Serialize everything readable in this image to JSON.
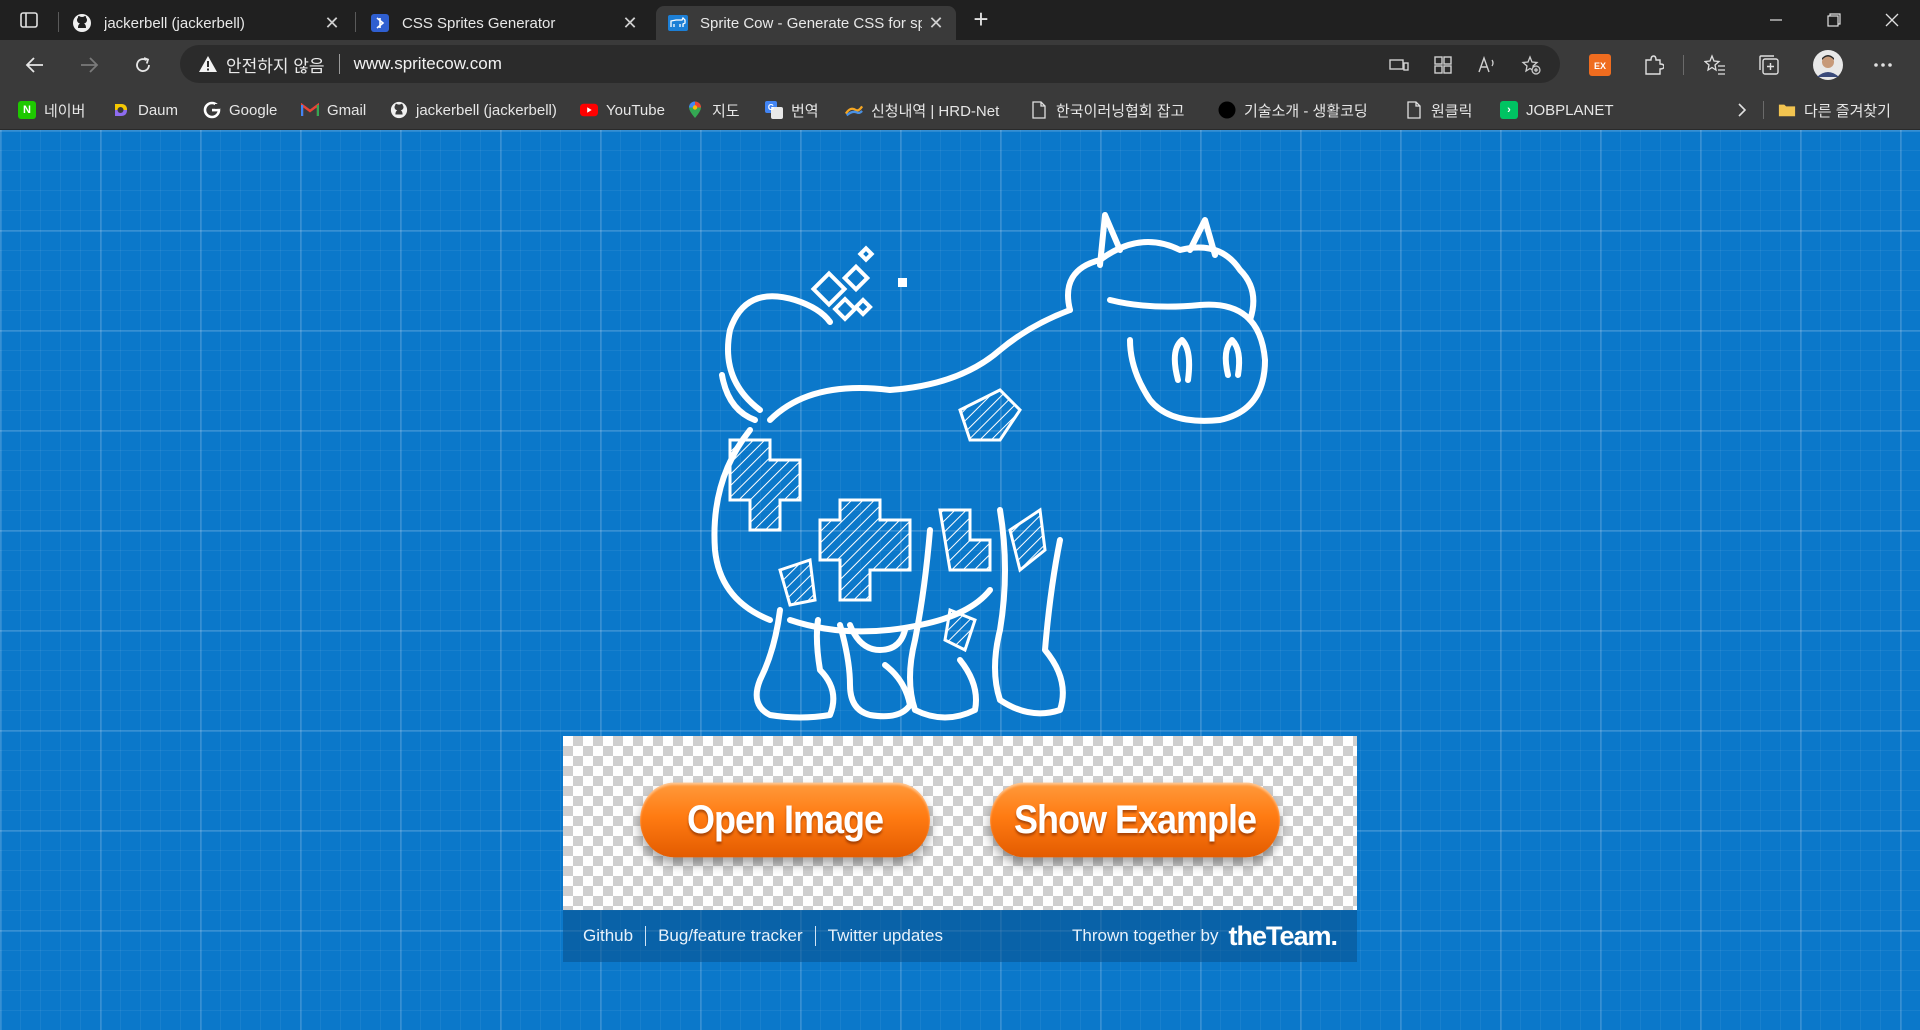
{
  "tabs": [
    {
      "title": "jackerbell (jackerbell)",
      "icon": "github-icon"
    },
    {
      "title": "CSS Sprites Generator",
      "icon": "sprites-generator-icon"
    },
    {
      "title": "Sprite Cow - Generate CSS for sp",
      "icon": "sprite-cow-icon"
    }
  ],
  "address": {
    "security_text": "안전하지 않음",
    "url": "www.spritecow.com"
  },
  "bookmarks": [
    {
      "label": "네이버",
      "icon": "naver-icon"
    },
    {
      "label": "Daum",
      "icon": "daum-icon"
    },
    {
      "label": "Google",
      "icon": "google-icon"
    },
    {
      "label": "Gmail",
      "icon": "gmail-icon"
    },
    {
      "label": "jackerbell (jackerbell)",
      "icon": "github-icon"
    },
    {
      "label": "YouTube",
      "icon": "youtube-icon"
    },
    {
      "label": "지도",
      "icon": "maps-icon"
    },
    {
      "label": "번역",
      "icon": "translate-icon"
    },
    {
      "label": "신청내역 | HRD-Net",
      "icon": "hrdnet-icon"
    },
    {
      "label": "한국이러닝협회 잡고",
      "icon": "page-icon"
    },
    {
      "label": "기술소개 - 생활코딩",
      "icon": "opentutorials-icon"
    },
    {
      "label": "원클릭",
      "icon": "page-icon"
    },
    {
      "label": "JOBPLANET",
      "icon": "jobplanet-icon"
    }
  ],
  "other_bookmarks": "다른 즐겨찾기",
  "main": {
    "open_image_label": "Open Image",
    "show_example_label": "Show Example"
  },
  "footer": {
    "links": [
      "Github",
      "Bug/feature tracker",
      "Twitter updates"
    ],
    "credit_text": "Thrown together by",
    "team_name": "theTeam."
  },
  "colors": {
    "page_background": "#0b78ca",
    "button_orange": "#ff7b12",
    "chrome_dark": "#202020",
    "chrome_toolbar": "#3a3a3a"
  }
}
